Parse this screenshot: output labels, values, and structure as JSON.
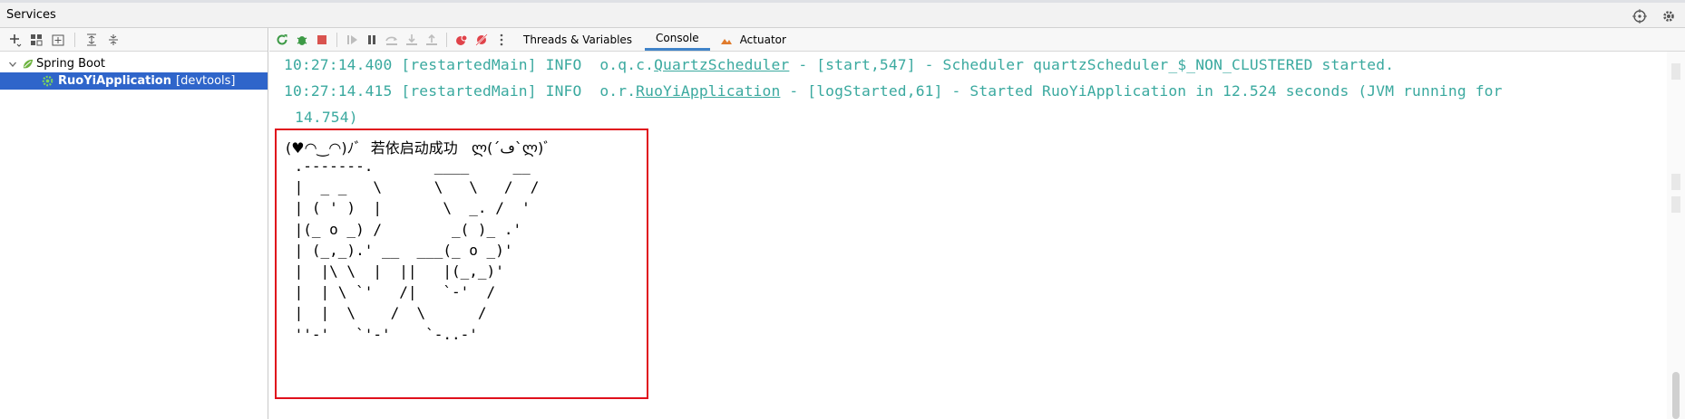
{
  "window": {
    "title": "Services"
  },
  "tree": {
    "group": "Spring Boot",
    "app_name": "RuoYiApplication",
    "app_tag": "[devtools]"
  },
  "tabs": [
    {
      "label": "Threads & Variables"
    },
    {
      "label": "Console"
    },
    {
      "label": "Actuator"
    }
  ],
  "log": {
    "line1": {
      "time": "10:27:14.400",
      "thread": "[restartedMain]",
      "level": "INFO",
      "logger_prefix": "o.q.c.",
      "logger_class": "QuartzScheduler",
      "rest": " - [start,547] - Scheduler quartzScheduler_$_NON_CLUSTERED started."
    },
    "line2": {
      "time": "10:27:14.415",
      "thread": "[restartedMain]",
      "level": "INFO",
      "logger_prefix": "o.r.",
      "logger_class": "RuoYiApplication",
      "rest": " - [logStarted,61] - Started RuoYiApplication in 12.524 seconds (JVM running for",
      "wrap": "14.754)"
    }
  },
  "banner": {
    "title": "(♥◠‿◠)ﾉﾞ  若依启动成功   ლ(´ڡ`ლ)ﾞ",
    "art": " .-------.       ____     __\n |  _ _   \\      \\   \\   /  /\n | ( ' )  |       \\  _. /  '\n |(_ o _) /        _( )_ .'\n | (_,_).' __  ___(_ o _)'\n |  |\\ \\  |  ||   |(_,_)'\n |  | \\ `'   /|   `-'  /\n |  |  \\    /  \\      /\n ''-'   `'-'    `-..-'"
  },
  "colors": {
    "log_text": "#3aa99f",
    "highlight_border": "#e0101c",
    "selection": "#2f65ca"
  }
}
